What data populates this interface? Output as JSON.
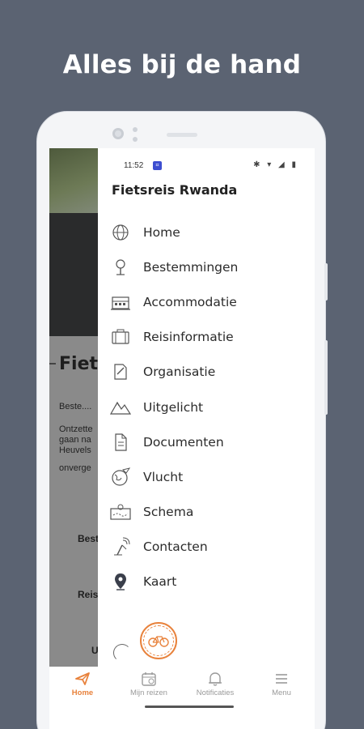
{
  "headline": "Alles bij de hand",
  "status_bar": {
    "time": "11:52",
    "icons": "✱ ▾ ◢ ▮"
  },
  "drawer": {
    "title": "Fietsreis Rwanda",
    "items": [
      {
        "label": "Home",
        "icon": "globe-icon"
      },
      {
        "label": "Bestemmingen",
        "icon": "tree-icon"
      },
      {
        "label": "Accommodatie",
        "icon": "hotel-icon"
      },
      {
        "label": "Reisinformatie",
        "icon": "suitcase-icon"
      },
      {
        "label": "Organisatie",
        "icon": "document-pen-icon"
      },
      {
        "label": "Uitgelicht",
        "icon": "mountains-icon"
      },
      {
        "label": "Documenten",
        "icon": "file-icon"
      },
      {
        "label": "Vlucht",
        "icon": "world-plane-icon"
      },
      {
        "label": "Schema",
        "icon": "map-route-icon"
      },
      {
        "label": "Contacten",
        "icon": "antenna-icon"
      },
      {
        "label": "Kaart",
        "icon": "map-pin-icon"
      }
    ]
  },
  "background_page": {
    "title": "Fiets",
    "line1": "Beste....",
    "para": [
      "Ontzette",
      "gaan na",
      "Heuvels",
      "onverge"
    ],
    "bold1": "Beste",
    "bold2": "Reis",
    "bold3": "U"
  },
  "tabbar": {
    "tabs": [
      {
        "label": "Home",
        "icon": "plane-icon",
        "active": true
      },
      {
        "label": "Mijn reizen",
        "icon": "calendar-icon",
        "active": false
      },
      {
        "label": "Notificaties",
        "icon": "bell-icon",
        "active": false
      },
      {
        "label": "Menu",
        "icon": "hamburger-icon",
        "active": false
      }
    ]
  },
  "colors": {
    "accent": "#e8823c",
    "background": "#5b6372",
    "brand_badge": "#3d4ed0"
  }
}
